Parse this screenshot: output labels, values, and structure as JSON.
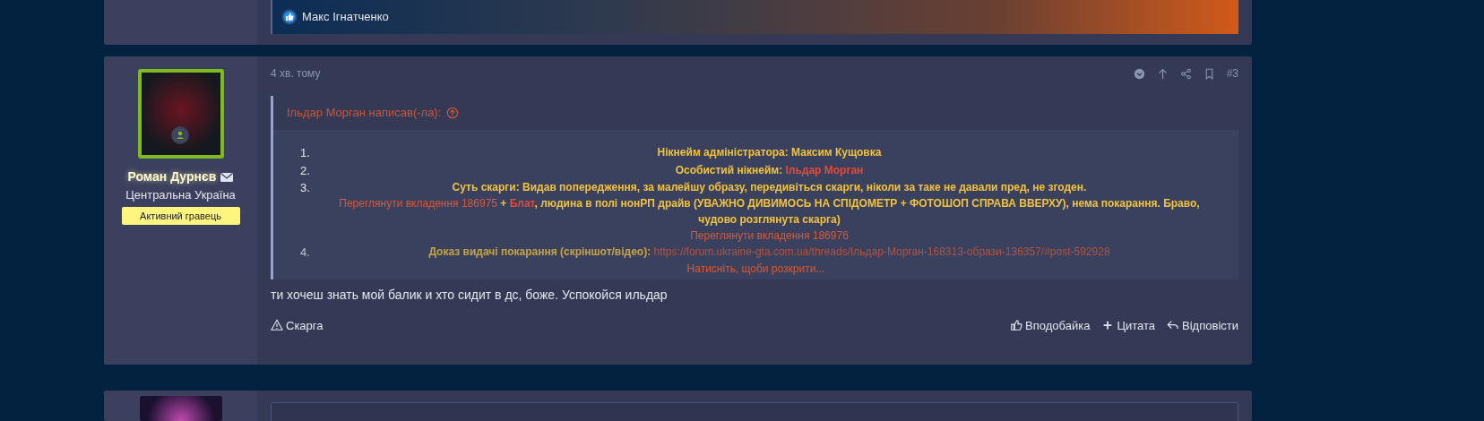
{
  "previous_post": {
    "reaction": {
      "user": "Макс Ігнатченко"
    }
  },
  "post": {
    "time": "4 хв. тому",
    "number": "#3",
    "author": {
      "name": "Роман Дурнєв",
      "location": "Центральна Україна",
      "rank": "Активний гравець",
      "online": true
    },
    "quote": {
      "header": "Ільдар Морган написав(-ла):",
      "items": [
        {
          "number": "1.",
          "lines": [
            [
              {
                "kind": "label",
                "text": "Нікнейм адміністратора: Максим Кущовка"
              }
            ]
          ]
        },
        {
          "number": "2.",
          "lines": [
            [
              {
                "kind": "label",
                "text": "Особистий нікнейм: "
              },
              {
                "kind": "name",
                "text": "Ільдар Морган"
              }
            ]
          ]
        },
        {
          "number": "3.",
          "lines": [
            [
              {
                "kind": "label",
                "text": "Суть скарги: Видав попередження, за малейшу образу, передивіться скарги, ніколи за таке не давали пред, не згоден."
              }
            ],
            [
              {
                "kind": "link",
                "text": "Переглянути вкладення 186975"
              },
              {
                "kind": "label",
                "text": " + "
              },
              {
                "kind": "name",
                "text": "Блат"
              },
              {
                "kind": "label",
                "text": ", людина в полі нонРП драйв (УВАЖНО ДИВИМОСЬ НА СПІДОМЕТР + ФОТОШОП СПРАВА ВВЕРХУ), нема покарання. Браво, чудово розглянута скарга)"
              }
            ],
            [
              {
                "kind": "link",
                "text": "Переглянути вкладення 186976"
              }
            ]
          ]
        },
        {
          "number": "4.",
          "lines": [
            [
              {
                "kind": "label",
                "text": "Доказ видачі покарання (скріншот/відео): "
              },
              {
                "kind": "link",
                "text": "https://forum.ukraine-gta.com.ua/threads/Ільдар-Морган-168313-образи-136357/#post-592928"
              }
            ]
          ]
        }
      ],
      "expand": "Натисніть, щоби розкрити..."
    },
    "body": "ти хочеш знать мой балик и хто сидит в дс, боже. Успокойся ильдар",
    "report": "Скарга",
    "actions": [
      {
        "kind": "like",
        "label": "Вподобайка"
      },
      {
        "kind": "quote",
        "label": "Цитата"
      },
      {
        "kind": "reply",
        "label": "Відповісти"
      }
    ]
  }
}
